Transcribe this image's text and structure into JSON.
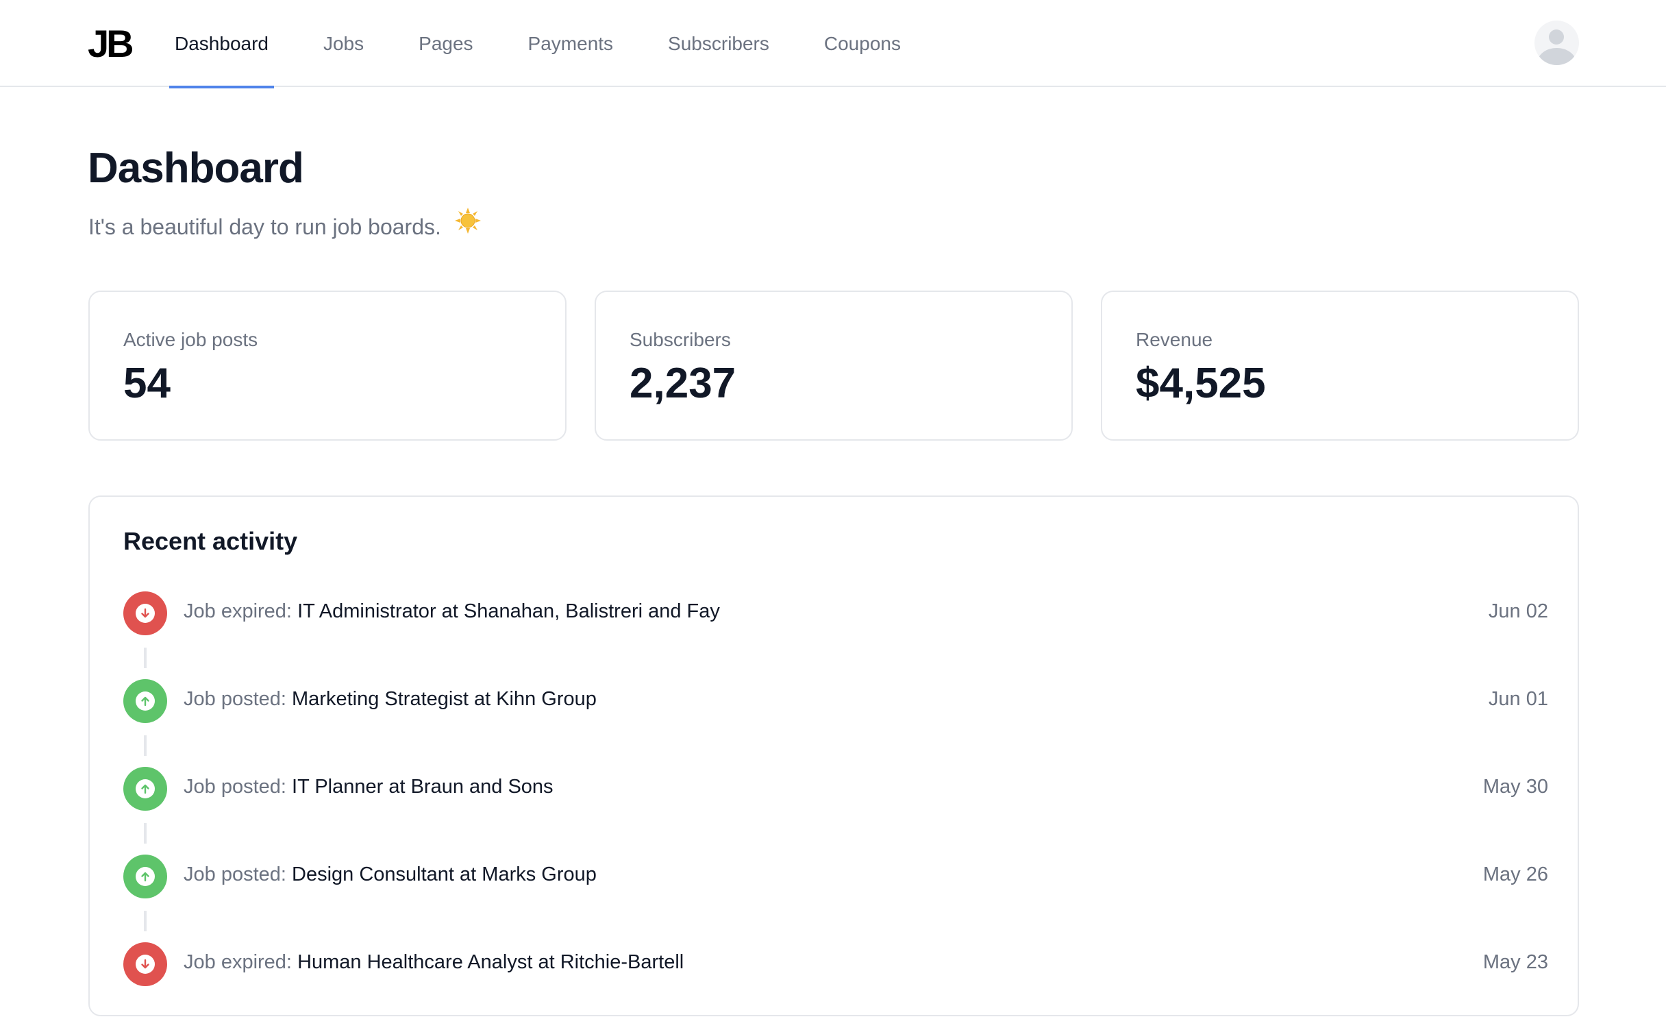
{
  "app": {
    "logo": "JB"
  },
  "nav": {
    "tabs": [
      {
        "label": "Dashboard",
        "active": true
      },
      {
        "label": "Jobs",
        "active": false
      },
      {
        "label": "Pages",
        "active": false
      },
      {
        "label": "Payments",
        "active": false
      },
      {
        "label": "Subscribers",
        "active": false
      },
      {
        "label": "Coupons",
        "active": false
      }
    ],
    "accent_color": "#4f83ea",
    "avatar_icon": "user-avatar-icon"
  },
  "header": {
    "title": "Dashboard",
    "subtitle": "It's a beautiful day to run job boards.",
    "subtitle_emoji": "☀️"
  },
  "stats": [
    {
      "label": "Active job posts",
      "value": "54"
    },
    {
      "label": "Subscribers",
      "value": "2,237"
    },
    {
      "label": "Revenue",
      "value": "$4,525"
    }
  ],
  "activity": {
    "title": "Recent activity",
    "status_colors": {
      "expired": "#e0524f",
      "posted": "#5ec46a"
    },
    "items": [
      {
        "status": "expired",
        "icon": "arrow-down-icon",
        "type": "Job expired:",
        "detail": "IT Administrator at Shanahan, Balistreri and Fay",
        "date": "Jun 02"
      },
      {
        "status": "posted",
        "icon": "arrow-up-icon",
        "type": "Job posted:",
        "detail": "Marketing Strategist at Kihn Group",
        "date": "Jun 01"
      },
      {
        "status": "posted",
        "icon": "arrow-up-icon",
        "type": "Job posted:",
        "detail": "IT Planner at Braun and Sons",
        "date": "May 30"
      },
      {
        "status": "posted",
        "icon": "arrow-up-icon",
        "type": "Job posted:",
        "detail": "Design Consultant at Marks Group",
        "date": "May 26"
      },
      {
        "status": "expired",
        "icon": "arrow-down-icon",
        "type": "Job expired:",
        "detail": "Human Healthcare Analyst at Ritchie-Bartell",
        "date": "May 23"
      }
    ]
  }
}
